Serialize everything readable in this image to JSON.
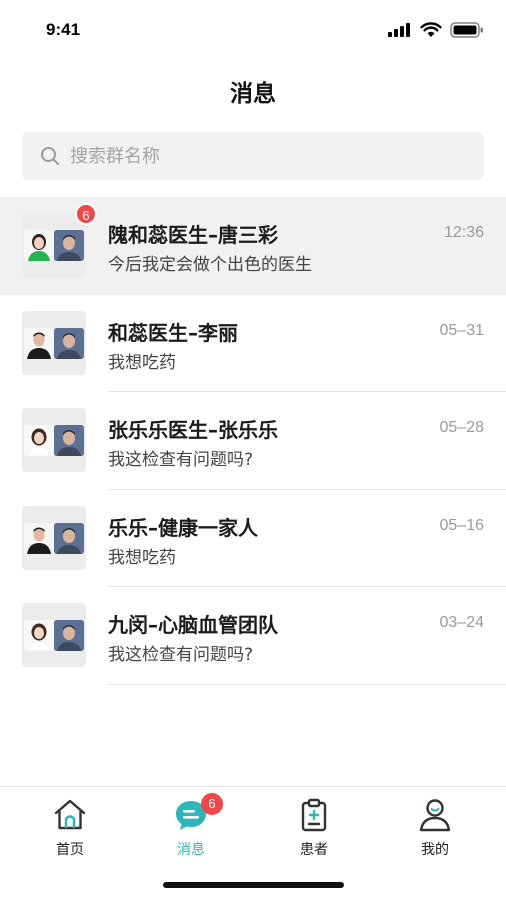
{
  "status_bar": {
    "time": "9:41"
  },
  "header": {
    "title": "消息"
  },
  "search": {
    "placeholder": "搜索群名称"
  },
  "conversations": [
    {
      "name": "隗和蕊医生–唐三彩",
      "message": "今后我定会做个出色的医生",
      "time": "12:36",
      "unread": "6",
      "left_avatar": "woman-green"
    },
    {
      "name": "和蕊医生–李丽",
      "message": "我想吃药",
      "time": "05–31",
      "unread": "",
      "left_avatar": "man-black"
    },
    {
      "name": "张乐乐医生–张乐乐",
      "message": "我这检查有问题吗?",
      "time": "05–28",
      "unread": "",
      "left_avatar": "woman-white"
    },
    {
      "name": "乐乐–健康一家人",
      "message": "我想吃药",
      "time": "05–16",
      "unread": "",
      "left_avatar": "man-black"
    },
    {
      "name": "九闵–心脑血管团队",
      "message": "我这检查有问题吗?",
      "time": "03–24",
      "unread": "",
      "left_avatar": "woman-white"
    }
  ],
  "tab_bar": {
    "tabs": [
      {
        "label": "首页",
        "icon": "home-icon"
      },
      {
        "label": "消息",
        "icon": "message-icon",
        "badge": "6",
        "active": true
      },
      {
        "label": "患者",
        "icon": "clipboard-icon"
      },
      {
        "label": "我的",
        "icon": "person-icon"
      }
    ]
  },
  "colors": {
    "accent": "#2cb6b9",
    "badge": "#f0474a",
    "active_row": "#f1f1f1"
  }
}
